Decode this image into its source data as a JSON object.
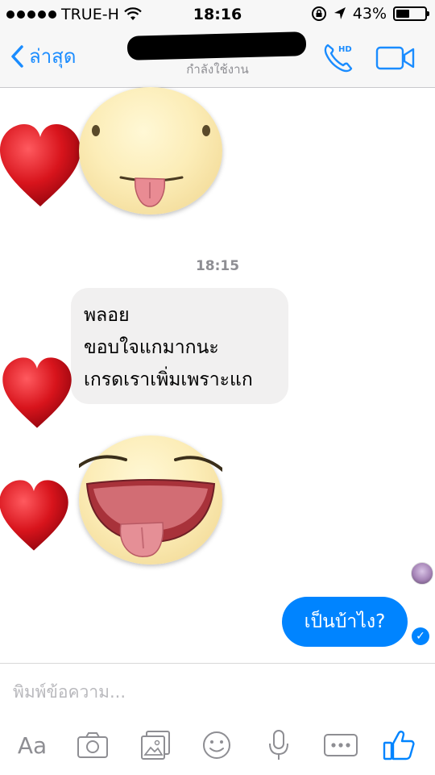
{
  "status_bar": {
    "carrier": "TRUE-H",
    "time": "18:16",
    "battery": "43%",
    "battery_level": 0.43,
    "icons": [
      "signal-dots-icon",
      "wifi-icon",
      "orientation-lock-icon",
      "location-arrow-icon",
      "battery-icon"
    ]
  },
  "header": {
    "back_label": "ล่าสุด",
    "status": "กำลังใช้งาน",
    "icons": [
      "chevron-left-icon",
      "hd-call-icon",
      "video-call-icon"
    ]
  },
  "conversation": {
    "timestamp": "18:15",
    "incoming_message_lines": [
      "พลอย",
      "ขอบใจแกมากนะ",
      "เกรดเราเพิ่มเพราะแก"
    ],
    "outgoing_message": "เป็นบ้าไง?",
    "stickers": [
      "heart-tongue-sticker",
      "heart-laughing-tongue-sticker"
    ],
    "reactions": [
      "heart-icon"
    ]
  },
  "composer": {
    "placeholder": "พิมพ์ข้อความ...",
    "aa_label": "Aa",
    "tools": [
      "text-format-icon",
      "camera-icon",
      "photo-icon",
      "emoji-icon",
      "microphone-icon",
      "more-icon",
      "thumbs-up-icon"
    ]
  },
  "colors": {
    "accent": "#0084ff",
    "nav_tint": "#1a8cff",
    "incoming_bubble": "#f1f0f0",
    "heart": "#d8141c"
  }
}
